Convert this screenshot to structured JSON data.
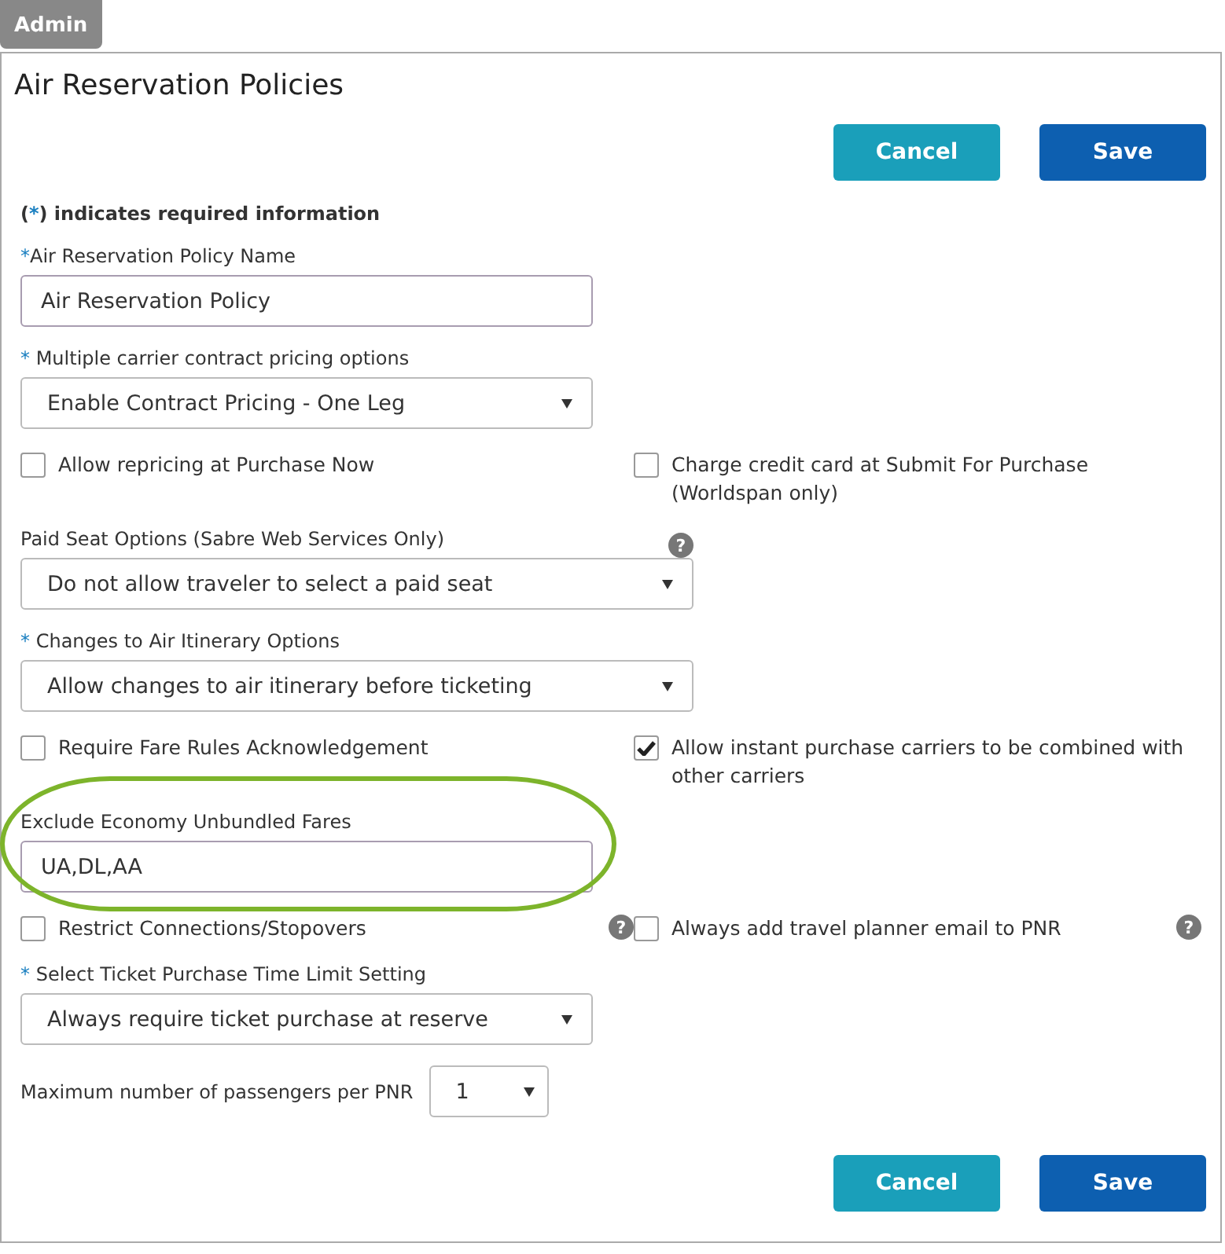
{
  "tab": {
    "label": "Admin",
    "selected": true
  },
  "title": "Air Reservation Policies",
  "top_buttons": [
    {
      "label": "Cancel",
      "kind": "cancel"
    },
    {
      "label": "Save",
      "kind": "save"
    }
  ],
  "required_note": {
    "open": "(",
    "mark": "*",
    "text": ") indicates required information"
  },
  "rows": [
    {
      "kind": "input",
      "label": "Air Reservation Policy Name",
      "required": true,
      "value": "Air Reservation Policy",
      "highlighted": false
    },
    {
      "kind": "select",
      "label": "Multiple carrier contract pricing options",
      "required": true,
      "value": "Enable Contract Pricing - One Leg"
    },
    {
      "kind": "checks",
      "items": [
        {
          "label": "Allow repricing at Purchase Now",
          "checked": false
        },
        {
          "label": "Charge credit card at Submit For Purchase (Worldspan only)",
          "checked": false
        }
      ]
    },
    {
      "kind": "wide_select",
      "label": "Paid Seat Options (Sabre Web Services Only)",
      "required": false,
      "value": "Do not allow traveler to select a paid seat",
      "help": "?"
    },
    {
      "kind": "wide_select",
      "label": "Changes to Air Itinerary Options",
      "required": true,
      "value": "Allow changes to air itinerary before ticketing"
    },
    {
      "kind": "checks",
      "items": [
        {
          "label": "Require Fare Rules Acknowledgement",
          "checked": false
        },
        {
          "label": "Allow instant purchase carriers to be combined with other carriers",
          "checked": true
        }
      ]
    },
    {
      "kind": "input",
      "label": "Exclude Economy Unbundled Fares",
      "required": false,
      "value": "UA,DL,AA",
      "highlighted": true
    },
    {
      "kind": "checks",
      "items": [
        {
          "label": "Restrict Connections/Stopovers",
          "checked": false,
          "help": "?"
        },
        {
          "label": "Always add travel planner email to PNR",
          "checked": false,
          "help": "?"
        }
      ]
    },
    {
      "kind": "select",
      "label": "Select Ticket Purchase Time Limit Setting",
      "required": true,
      "value": "Always require ticket purchase at reserve"
    },
    {
      "kind": "inline_select",
      "label": "Maximum number of passengers per PNR",
      "value": "1"
    }
  ],
  "bottom_buttons": [
    {
      "label": "Cancel",
      "kind": "cancel"
    },
    {
      "label": "Save",
      "kind": "save"
    }
  ]
}
